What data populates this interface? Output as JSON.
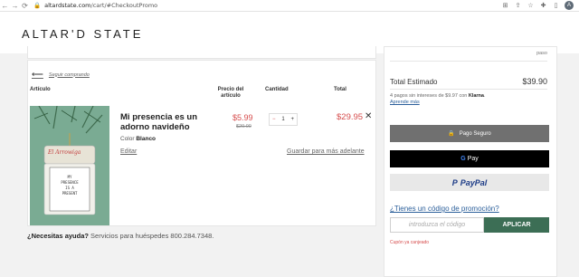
{
  "browser": {
    "url_host": "altardstate.com",
    "url_path": "/cart/#CheckoutPromo",
    "profile_initial": "A"
  },
  "header": {
    "logo": "ALTAR'D STATE"
  },
  "cart": {
    "back_link": "Seguir comprando",
    "columns": {
      "article": "Artículo",
      "unit_price": "Precio del artículo",
      "quantity": "Cantidad",
      "total": "Total"
    },
    "item": {
      "title": "Mi presencia es un adorno navideño",
      "color_label": "Color",
      "color_value": "Blanco",
      "price": "$5.99",
      "original_price": "$20.00",
      "quantity": "1",
      "total": "$29.95",
      "edit_label": "Editar",
      "save_label": "Guardar para más adelante",
      "ornament_text": {
        "sign": "El Arrowiga",
        "body_1": "MY",
        "body_2": "PRESENCE",
        "body_3": "IS A",
        "body_4": "PRESENT"
      }
    },
    "help_bold": "¿Necesitas ayuda?",
    "help_text": "Servicios para huéspedes 800.284.7348."
  },
  "summary": {
    "top_text": "paso",
    "estimated_label": "Total Estimado",
    "estimated_value": "$39.90",
    "klarna_text": "4 pagos sin intereses de $9.97 con",
    "klarna_brand": "Klarna",
    "klarna_more": "Aprende más",
    "secure_pay": "Pago Seguro",
    "gpay": "Pay",
    "paypal": "PayPal",
    "promo_question": "¿Tienes un código de promoción?",
    "promo_placeholder": "introduzca el código",
    "apply_label": "APLICAR",
    "coupon_note": "Cupón ya canjeado"
  },
  "colors": {
    "accent_green": "#3c6e55",
    "sale_red": "#d64d4d"
  }
}
